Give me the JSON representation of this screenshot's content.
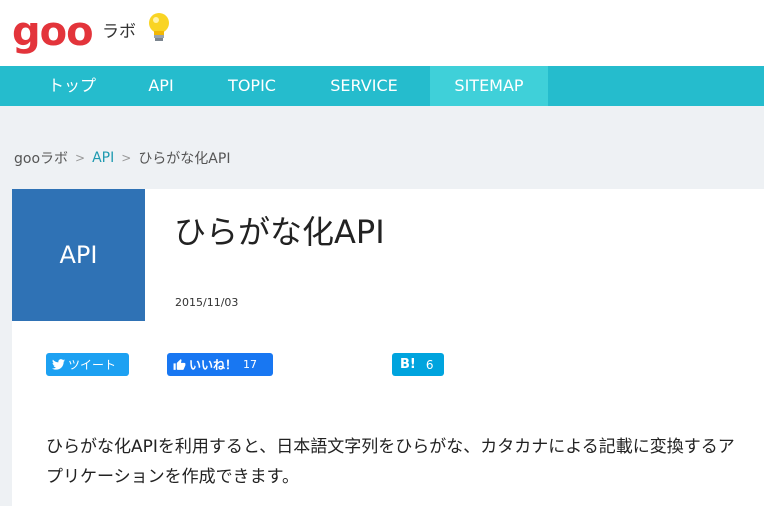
{
  "header": {
    "logo_text": "goo",
    "lab_label": "ラボ",
    "bulb_icon": "lightbulb-icon"
  },
  "nav": {
    "items": [
      {
        "label": "トップ"
      },
      {
        "label": "API"
      },
      {
        "label": "TOPIC"
      },
      {
        "label": "SERVICE"
      },
      {
        "label": "SITEMAP",
        "active": true
      }
    ]
  },
  "breadcrumb": {
    "home": "gooラボ",
    "section": "API",
    "current": "ひらがな化API"
  },
  "article": {
    "thumb_label": "API",
    "title": "ひらがな化API",
    "date": "2015/11/03",
    "description": "ひらがな化APIを利用すると、日本語文字列をひらがな、カタカナによる記載に変換するアプリケーションを作成できます。"
  },
  "share": {
    "tweet_label": "ツイート",
    "like_label": "いいね！",
    "like_count": "17",
    "hatena_mark": "B!",
    "hatena_count": "6"
  },
  "colors": {
    "brand_red": "#e3343b",
    "nav_bg": "#25bccd",
    "nav_active": "#3fd0d9",
    "thumb_bg": "#2f72b5",
    "link": "#1f9ab0"
  }
}
